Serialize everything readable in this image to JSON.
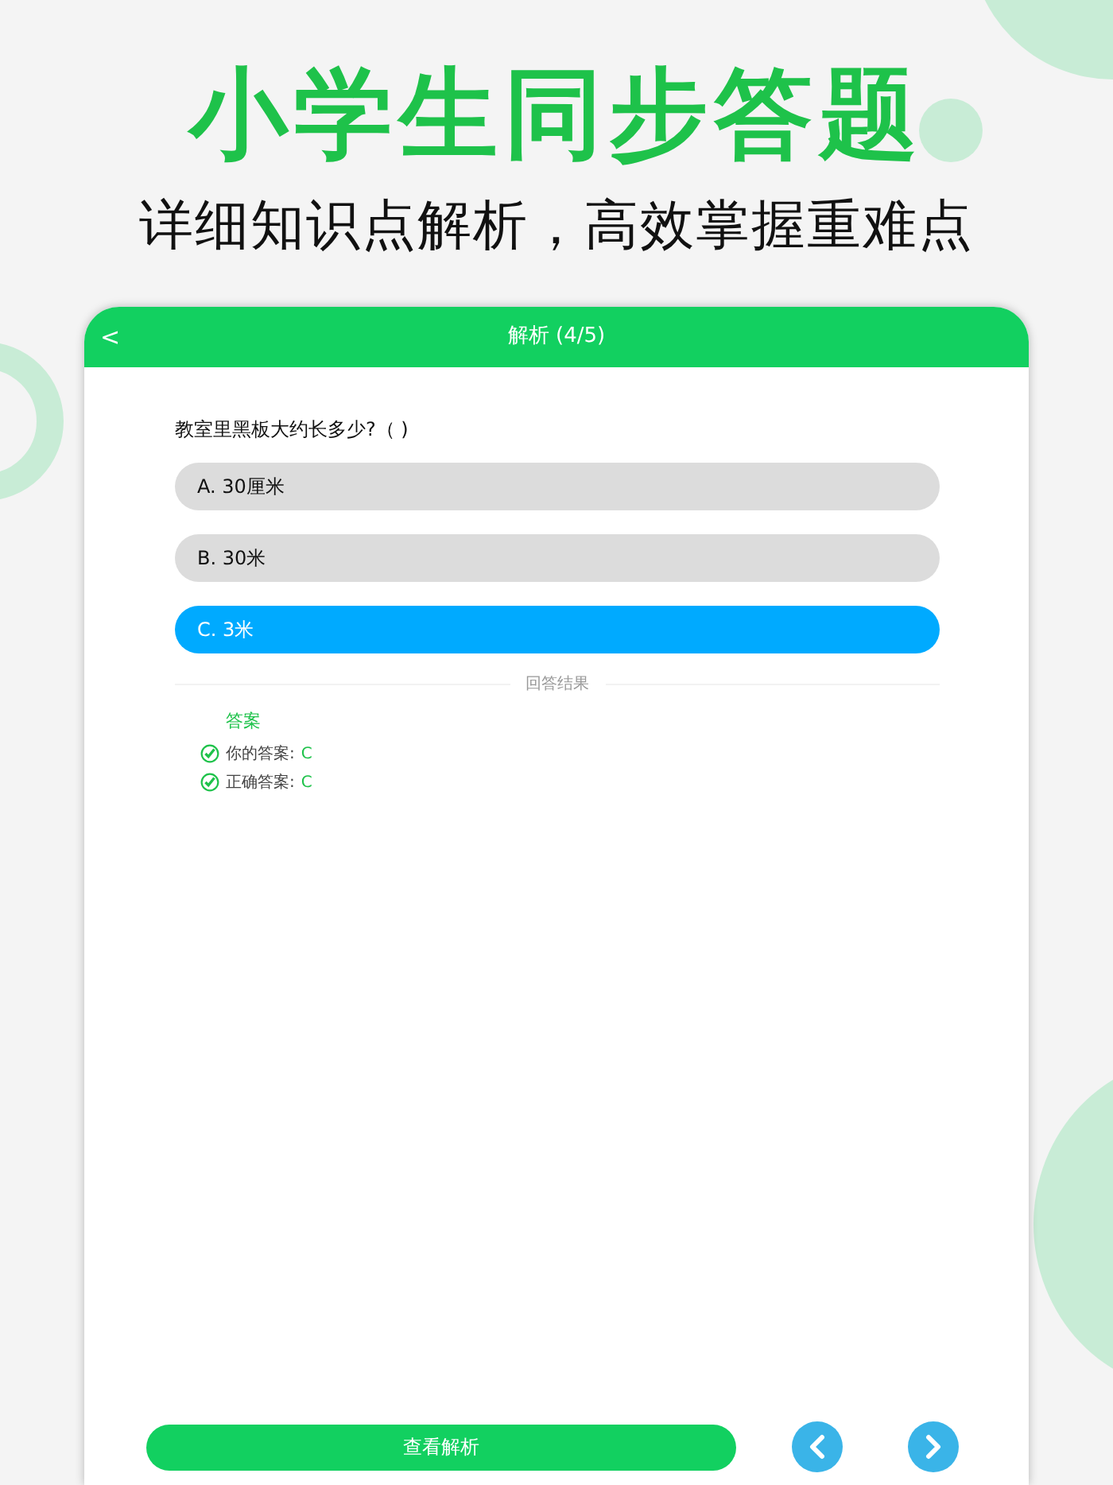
{
  "headline": "小学生同步答题",
  "subtitle": "详细知识点解析，高效掌握重难点",
  "header": {
    "back": "<",
    "title": "解析 (4/5)"
  },
  "question": "教室里黑板大约长多少?（ )",
  "options": [
    {
      "label": "A. 30厘米",
      "selected": false
    },
    {
      "label": "B. 30米",
      "selected": false
    },
    {
      "label": "C. 3米",
      "selected": true
    }
  ],
  "divider": "回答结果",
  "answer": {
    "heading": "答案",
    "rows": [
      {
        "label": "你的答案:",
        "value": "C",
        "correct": true
      },
      {
        "label": "正确答案:",
        "value": "C",
        "correct": true
      }
    ]
  },
  "footer": {
    "button": "查看解析"
  }
}
